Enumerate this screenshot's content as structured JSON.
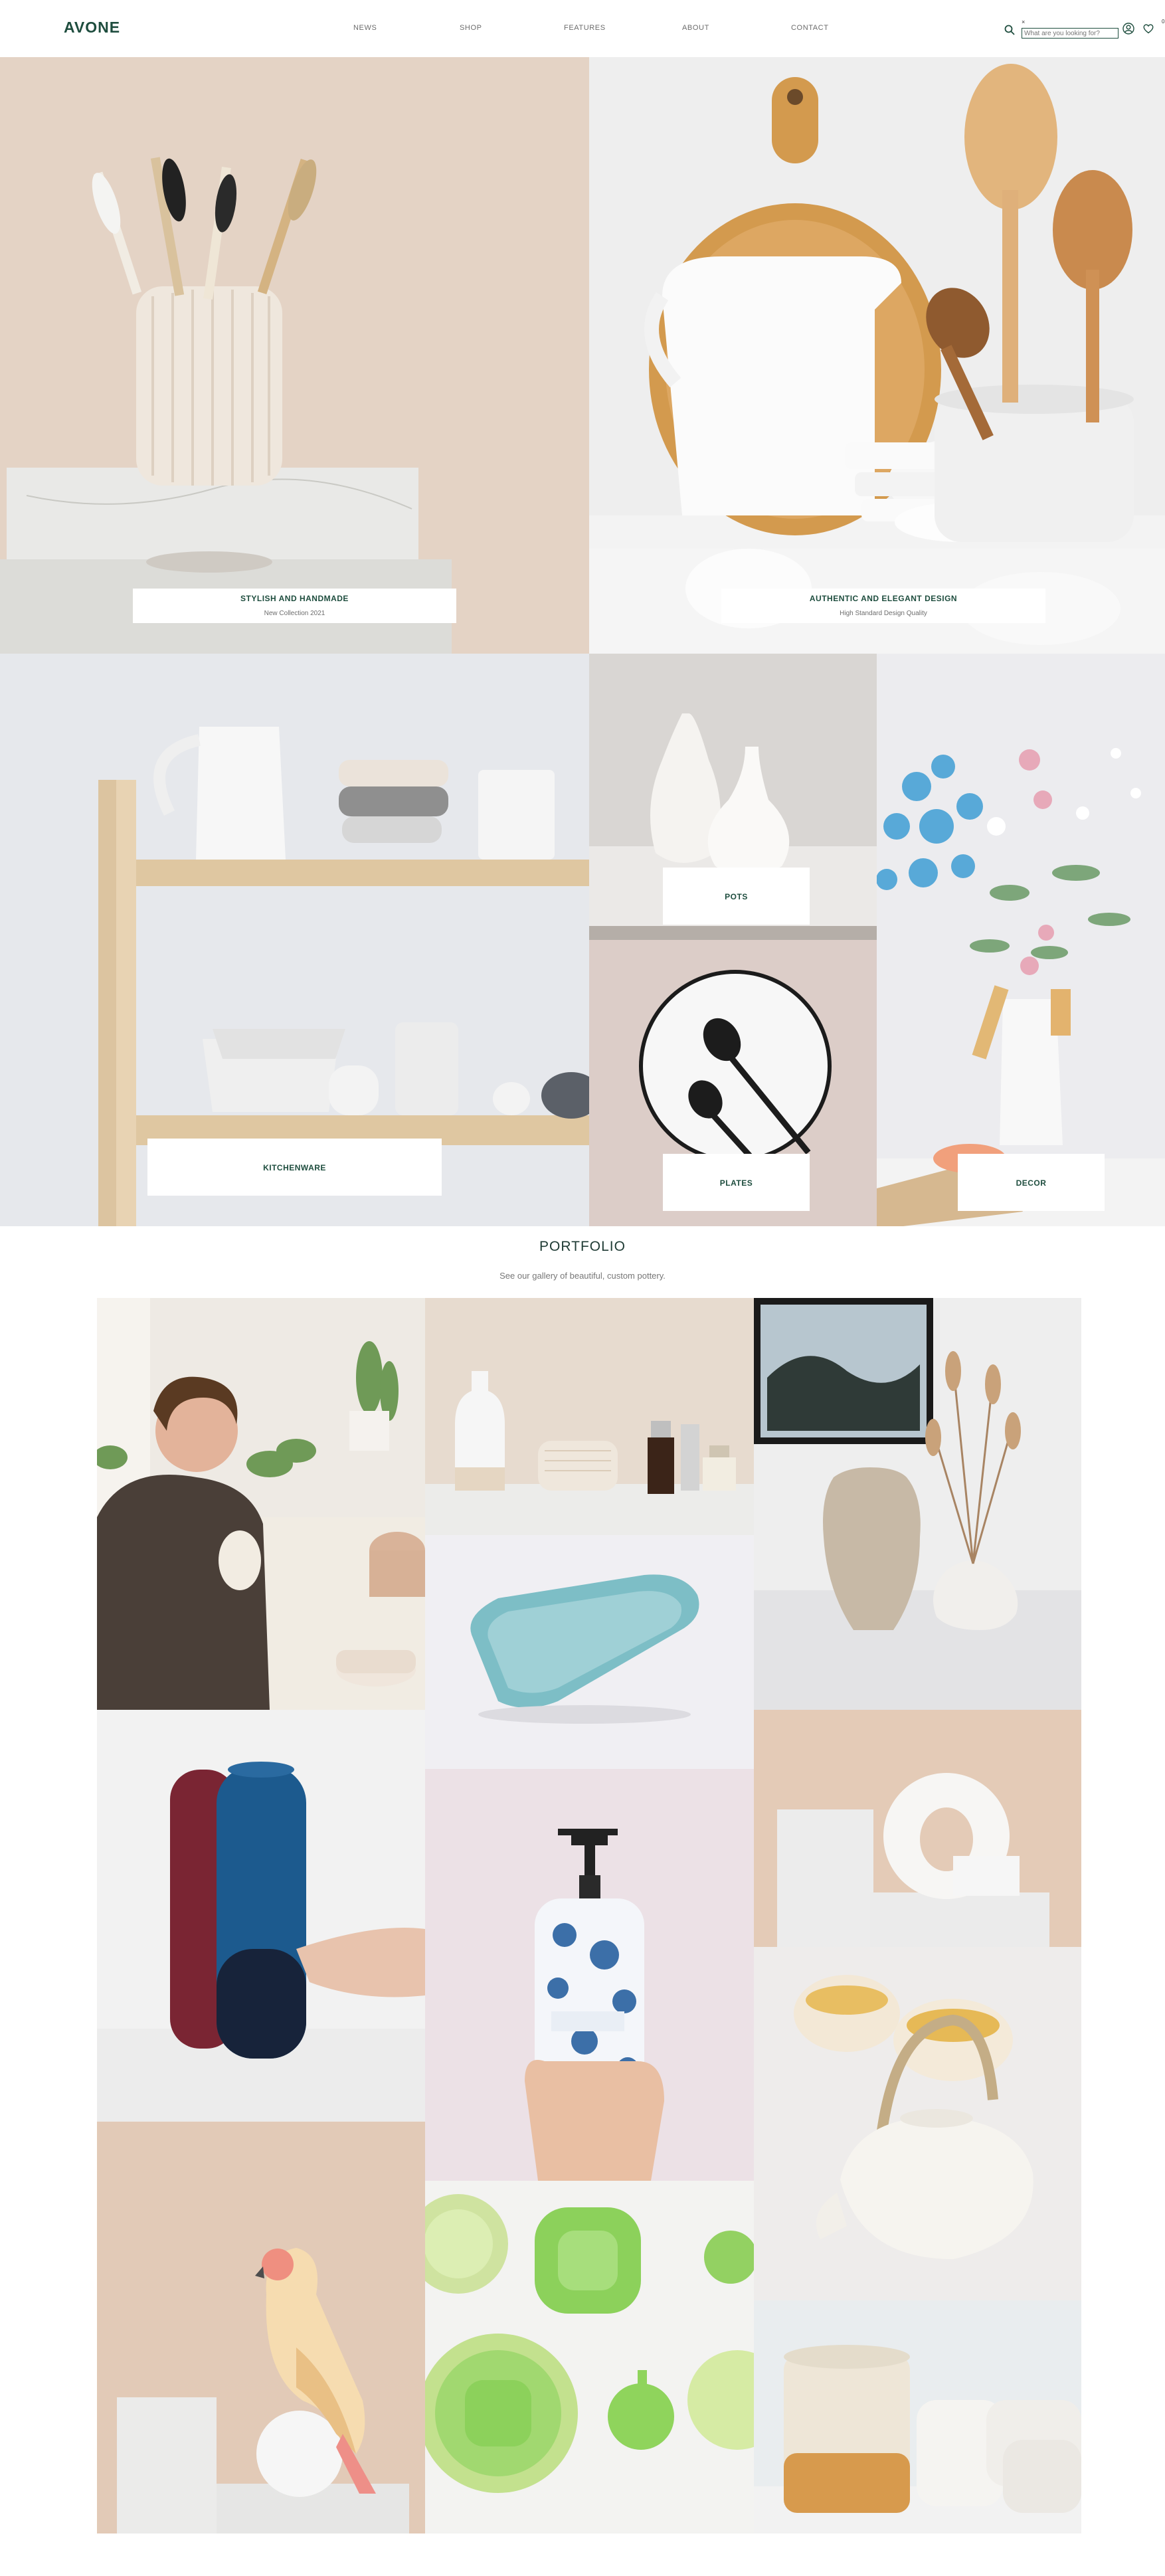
{
  "header": {
    "logo": "AVONE",
    "nav": [
      "NEWS",
      "SHOP",
      "FEATURES",
      "ABOUT",
      "CONTACT"
    ],
    "search": {
      "placeholder": "What are you looking for?",
      "close": "×"
    },
    "wishlist_count": "0"
  },
  "banners": {
    "left": {
      "title": "STYLISH AND HANDMADE",
      "subtitle": "New Collection 2021"
    },
    "right": {
      "title": "AUTHENTIC AND ELEGANT DESIGN",
      "subtitle": "High Standard Design Quality"
    }
  },
  "categories": {
    "kitchenware": "KITCHENWARE",
    "pots": "POTS",
    "plates": "PLATES",
    "decor": "DECOR"
  },
  "portfolio": {
    "title": "PORTFOLIO",
    "subtitle": "See our gallery of beautiful, custom pottery."
  },
  "icons": [
    "search-icon",
    "account-icon",
    "heart-icon"
  ],
  "colors": {
    "brand": "#1e4d3e",
    "accent_beige": "#e4d3c5"
  }
}
